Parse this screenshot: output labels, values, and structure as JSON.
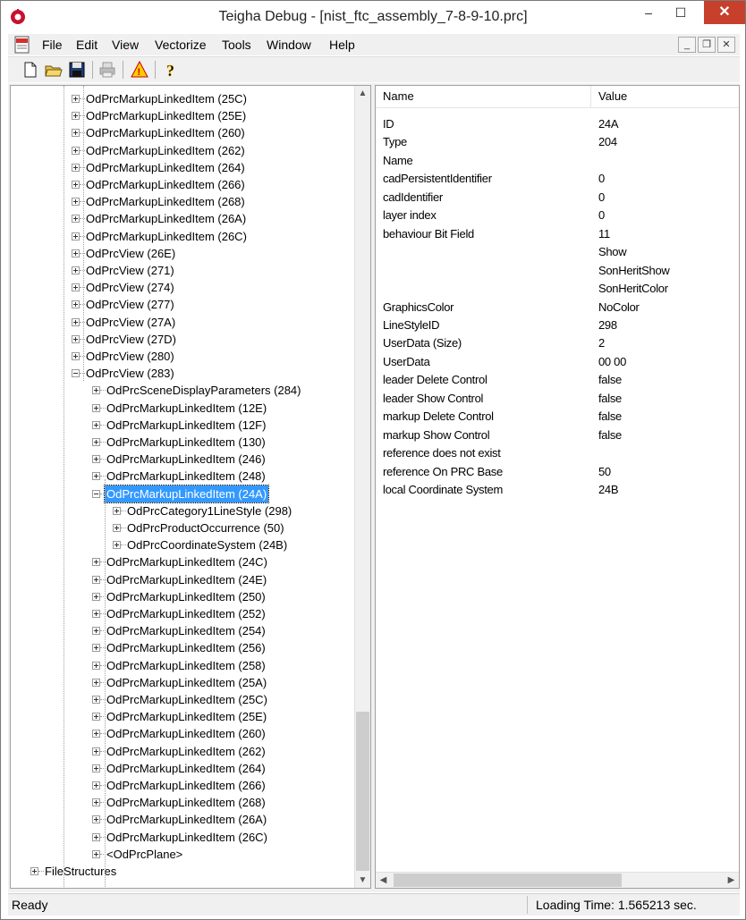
{
  "window": {
    "title": "Teigha Debug - [nist_ftc_assembly_7-8-9-10.prc]",
    "minimize": "–",
    "maximize": "☐",
    "close": "✕"
  },
  "menu": {
    "items": [
      "File",
      "Edit",
      "View",
      "Vectorize",
      "Tools",
      "Window",
      "Help"
    ],
    "mdi_min": "_",
    "mdi_restore": "❐",
    "mdi_close": "✕"
  },
  "toolbar": {
    "buttons": [
      "new-document",
      "open-folder",
      "save-disk",
      "print",
      "warning-triangle",
      "help-question"
    ]
  },
  "tree": {
    "items": [
      {
        "label": "OdPrcMarkupLinkedItem (25C)",
        "level": 3,
        "expander": "plus"
      },
      {
        "label": "OdPrcMarkupLinkedItem (25E)",
        "level": 3,
        "expander": "plus"
      },
      {
        "label": "OdPrcMarkupLinkedItem (260)",
        "level": 3,
        "expander": "plus"
      },
      {
        "label": "OdPrcMarkupLinkedItem (262)",
        "level": 3,
        "expander": "plus"
      },
      {
        "label": "OdPrcMarkupLinkedItem (264)",
        "level": 3,
        "expander": "plus"
      },
      {
        "label": "OdPrcMarkupLinkedItem (266)",
        "level": 3,
        "expander": "plus"
      },
      {
        "label": "OdPrcMarkupLinkedItem (268)",
        "level": 3,
        "expander": "plus"
      },
      {
        "label": "OdPrcMarkupLinkedItem (26A)",
        "level": 3,
        "expander": "plus"
      },
      {
        "label": "OdPrcMarkupLinkedItem (26C)",
        "level": 3,
        "expander": "plus"
      },
      {
        "label": "OdPrcView (26E)",
        "level": 3,
        "expander": "plus"
      },
      {
        "label": "OdPrcView (271)",
        "level": 3,
        "expander": "plus"
      },
      {
        "label": "OdPrcView (274)",
        "level": 3,
        "expander": "plus"
      },
      {
        "label": "OdPrcView (277)",
        "level": 3,
        "expander": "plus"
      },
      {
        "label": "OdPrcView (27A)",
        "level": 3,
        "expander": "plus"
      },
      {
        "label": "OdPrcView (27D)",
        "level": 3,
        "expander": "plus"
      },
      {
        "label": "OdPrcView (280)",
        "level": 3,
        "expander": "plus"
      },
      {
        "label": "OdPrcView (283)",
        "level": 3,
        "expander": "minus"
      },
      {
        "label": "OdPrcSceneDisplayParameters (284)",
        "level": 4,
        "expander": "plus"
      },
      {
        "label": "OdPrcMarkupLinkedItem (12E)",
        "level": 4,
        "expander": "plus"
      },
      {
        "label": "OdPrcMarkupLinkedItem (12F)",
        "level": 4,
        "expander": "plus"
      },
      {
        "label": "OdPrcMarkupLinkedItem (130)",
        "level": 4,
        "expander": "plus"
      },
      {
        "label": "OdPrcMarkupLinkedItem (246)",
        "level": 4,
        "expander": "plus"
      },
      {
        "label": "OdPrcMarkupLinkedItem (248)",
        "level": 4,
        "expander": "plus"
      },
      {
        "label": "OdPrcMarkupLinkedItem (24A)",
        "level": 4,
        "expander": "minus",
        "selected": true
      },
      {
        "label": "OdPrcCategory1LineStyle (298)",
        "level": 5,
        "expander": "plus"
      },
      {
        "label": "OdPrcProductOccurrence (50)",
        "level": 5,
        "expander": "plus"
      },
      {
        "label": "OdPrcCoordinateSystem (24B)",
        "level": 5,
        "expander": "plus"
      },
      {
        "label": "OdPrcMarkupLinkedItem (24C)",
        "level": 4,
        "expander": "plus"
      },
      {
        "label": "OdPrcMarkupLinkedItem (24E)",
        "level": 4,
        "expander": "plus"
      },
      {
        "label": "OdPrcMarkupLinkedItem (250)",
        "level": 4,
        "expander": "plus"
      },
      {
        "label": "OdPrcMarkupLinkedItem (252)",
        "level": 4,
        "expander": "plus"
      },
      {
        "label": "OdPrcMarkupLinkedItem (254)",
        "level": 4,
        "expander": "plus"
      },
      {
        "label": "OdPrcMarkupLinkedItem (256)",
        "level": 4,
        "expander": "plus"
      },
      {
        "label": "OdPrcMarkupLinkedItem (258)",
        "level": 4,
        "expander": "plus"
      },
      {
        "label": "OdPrcMarkupLinkedItem (25A)",
        "level": 4,
        "expander": "plus"
      },
      {
        "label": "OdPrcMarkupLinkedItem (25C)",
        "level": 4,
        "expander": "plus"
      },
      {
        "label": "OdPrcMarkupLinkedItem (25E)",
        "level": 4,
        "expander": "plus"
      },
      {
        "label": "OdPrcMarkupLinkedItem (260)",
        "level": 4,
        "expander": "plus"
      },
      {
        "label": "OdPrcMarkupLinkedItem (262)",
        "level": 4,
        "expander": "plus"
      },
      {
        "label": "OdPrcMarkupLinkedItem (264)",
        "level": 4,
        "expander": "plus"
      },
      {
        "label": "OdPrcMarkupLinkedItem (266)",
        "level": 4,
        "expander": "plus"
      },
      {
        "label": "OdPrcMarkupLinkedItem (268)",
        "level": 4,
        "expander": "plus"
      },
      {
        "label": "OdPrcMarkupLinkedItem (26A)",
        "level": 4,
        "expander": "plus"
      },
      {
        "label": "OdPrcMarkupLinkedItem (26C)",
        "level": 4,
        "expander": "plus"
      },
      {
        "label": "<OdPrcPlane>",
        "level": 4,
        "expander": "plus"
      },
      {
        "label": "FileStructures",
        "level": 1,
        "expander": "plus"
      }
    ]
  },
  "properties": {
    "header": {
      "name": "Name",
      "value": "Value"
    },
    "rows": [
      {
        "name": "ID",
        "value": "24A"
      },
      {
        "name": "Type",
        "value": "204"
      },
      {
        "name": "Name",
        "value": ""
      },
      {
        "name": "cadPersistentIdentifier",
        "value": "0"
      },
      {
        "name": "cadIdentifier",
        "value": "0"
      },
      {
        "name": "layer index",
        "value": "0"
      },
      {
        "name": "behaviour Bit Field",
        "value": "11"
      },
      {
        "name": "",
        "value": "Show"
      },
      {
        "name": "",
        "value": "SonHeritShow"
      },
      {
        "name": "",
        "value": "SonHeritColor"
      },
      {
        "name": "GraphicsColor",
        "value": "NoColor"
      },
      {
        "name": "LineStyleID",
        "value": "298"
      },
      {
        "name": "UserData (Size)",
        "value": "2"
      },
      {
        "name": "UserData",
        "value": "00 00"
      },
      {
        "name": "leader Delete Control",
        "value": "false"
      },
      {
        "name": "leader Show Control",
        "value": "false"
      },
      {
        "name": "markup Delete Control",
        "value": "false"
      },
      {
        "name": "markup Show Control",
        "value": "false"
      },
      {
        "name": "reference does not exist",
        "value": ""
      },
      {
        "name": "reference On PRC Base",
        "value": "50"
      },
      {
        "name": "local Coordinate System",
        "value": "24B"
      }
    ]
  },
  "status": {
    "left": "Ready",
    "right": "Loading Time: 1.565213 sec."
  },
  "colors": {
    "selection": "#3399ff",
    "close": "#c7402c"
  }
}
